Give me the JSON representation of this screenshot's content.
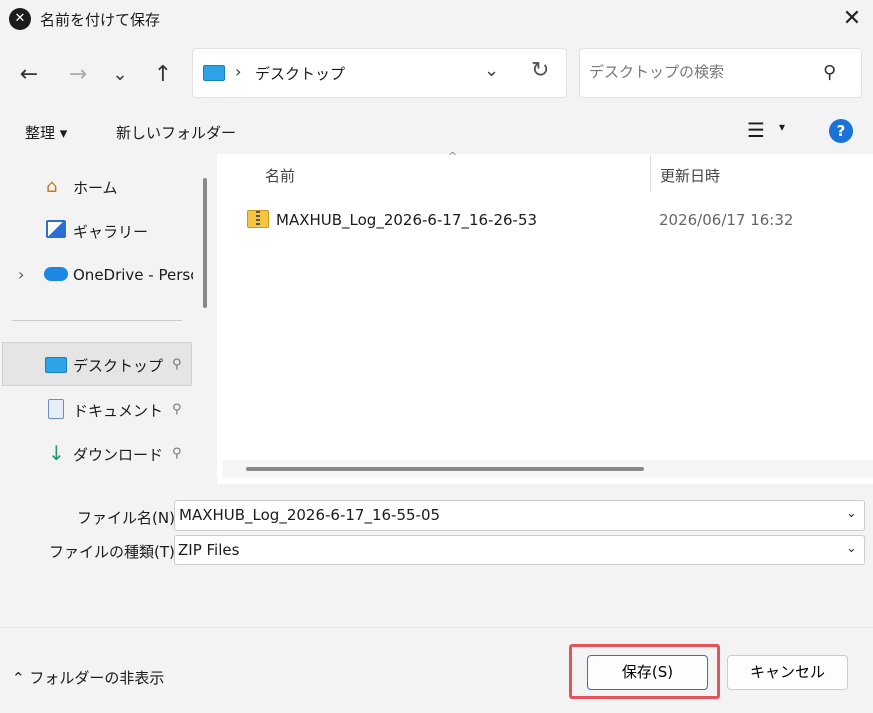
{
  "window": {
    "title": "名前を付けて保存",
    "app_icon": "x-logo-icon",
    "close_glyph": "✕"
  },
  "nav": {
    "back": "←",
    "forward": "→",
    "recent": "⌄",
    "up": "↑"
  },
  "address": {
    "separator": "›",
    "path": "デスクトップ",
    "dropdown": "⌄",
    "refresh": "↻"
  },
  "search": {
    "placeholder": "デスクトップの検索",
    "value": "",
    "icon_glyph": "⚲"
  },
  "toolbar": {
    "organize": "整理 ▾",
    "new_folder": "新しいフォルダー",
    "view_glyph": "☰",
    "view_dropdown": "▾",
    "help": "?"
  },
  "sidebar": {
    "items": [
      {
        "label": "ホーム",
        "icon": "home-icon"
      },
      {
        "label": "ギャラリー",
        "icon": "gallery-icon"
      },
      {
        "label": "OneDrive - Perso",
        "icon": "onedrive-icon",
        "expander": "›"
      },
      {
        "label": "デスクトップ",
        "icon": "desktop-folder-icon",
        "pinned": true,
        "selected": true
      },
      {
        "label": "ドキュメント",
        "icon": "documents-icon",
        "pinned": true
      },
      {
        "label": "ダウンロード",
        "icon": "download-icon",
        "pinned": true
      }
    ],
    "pin_glyph": "📌"
  },
  "filelist": {
    "columns": {
      "name": "名前",
      "date": "更新日時",
      "sort_glyph": "^"
    },
    "rows": [
      {
        "name": "MAXHUB_Log_2026-6-17_16-26-53",
        "date": "2026/06/17 16:32",
        "icon": "zip-folder-icon"
      }
    ]
  },
  "form": {
    "filename_label": "ファイル名(N):",
    "filename_value": "MAXHUB_Log_2026-6-17_16-55-05",
    "filetype_label": "ファイルの種類(T):",
    "filetype_value": "ZIP Files",
    "dropdown_glyph": "⌄"
  },
  "footer": {
    "hide_folders": "⌃ フォルダーの非表示",
    "save": "保存(S)",
    "cancel": "キャンセル",
    "highlight_color": "#e8525a"
  }
}
